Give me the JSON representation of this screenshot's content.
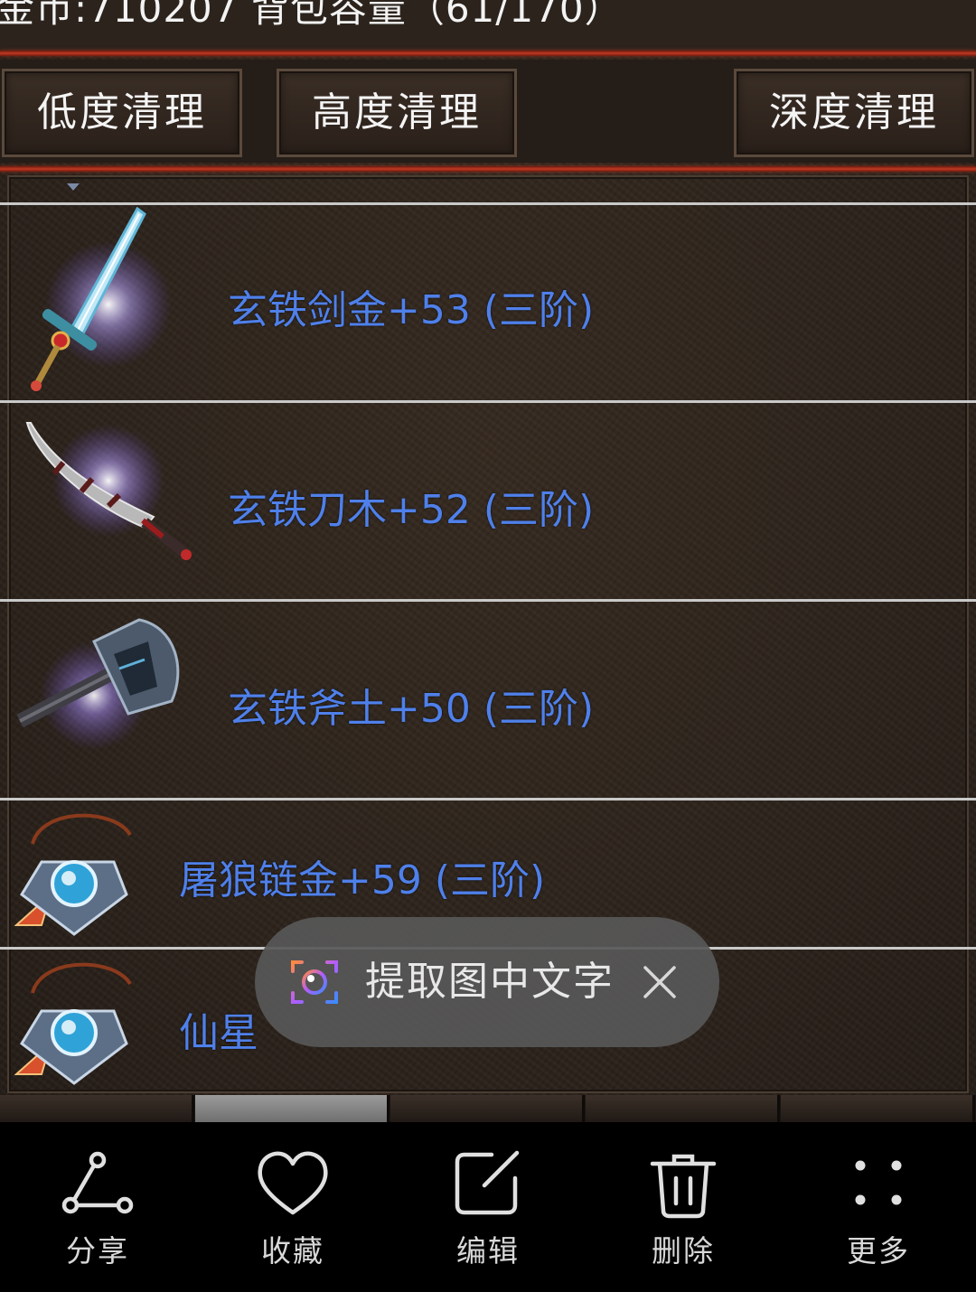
{
  "game": {
    "status_line": "金币:710207 背包容量（61/170）",
    "buttons": {
      "low_clean": "低度清理",
      "high_clean": "高度清理",
      "deep_clean": "深度清理"
    },
    "items": [
      {
        "name": "玄铁剑金+53 (三阶)",
        "icon": "sword-icon"
      },
      {
        "name": "玄铁刀木+52 (三阶)",
        "icon": "saber-icon"
      },
      {
        "name": "玄铁斧土+50 (三阶)",
        "icon": "axe-icon"
      },
      {
        "name": "屠狼链金+59 (三阶)",
        "icon": "amulet-icon"
      },
      {
        "name": "仙星",
        "icon": "amulet-icon"
      }
    ],
    "colors": {
      "item_name": "#4f80ea",
      "accent_red": "#c03a22"
    }
  },
  "toast": {
    "label": "提取图中文字",
    "icon": "scan-text-icon",
    "close_icon": "close-icon"
  },
  "bottom_bar": {
    "share": "分享",
    "favorite": "收藏",
    "edit": "编辑",
    "delete": "删除",
    "more": "更多"
  }
}
